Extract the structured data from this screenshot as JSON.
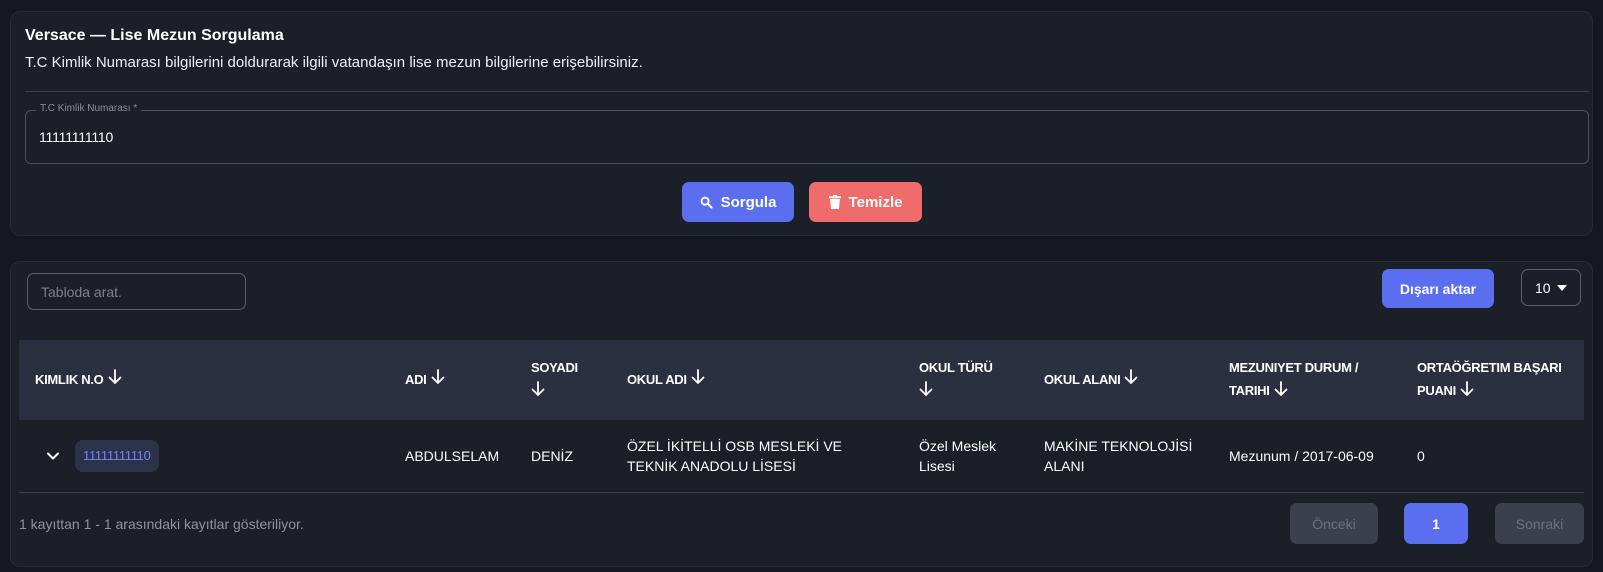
{
  "query": {
    "title": "Versace — Lise Mezun Sorgulama",
    "subtitle": "T.C Kimlik Numarası bilgilerini doldurarak ilgili vatandaşın lise mezun bilgilerine erişebilirsiniz.",
    "field_label": "T.C Kimlik Numarası *",
    "field_value": "11111111110",
    "search_label": "Sorgula",
    "clear_label": "Temizle"
  },
  "table": {
    "search_placeholder": "Tabloda arat.",
    "export_label": "Dışarı aktar",
    "page_size": "10",
    "columns": [
      "KIMLIK N.O",
      "ADI",
      "SOYADI",
      "OKUL ADI",
      "OKUL TÜRÜ",
      "OKUL ALANI",
      "MEZUNIYET DURUM / TARIHI",
      "ORTAÖĞRETIM BAŞARI PUANI"
    ],
    "rows": [
      {
        "kimlik": "11111111110",
        "adi": "ABDULSELAM",
        "soyadi": "DENİZ",
        "okul_adi": "ÖZEL İKİTELLİ OSB MESLEKİ VE TEKNİK ANADOLU LİSESİ",
        "okul_turu": "Özel Meslek Lisesi",
        "okul_alani": "MAKİNE TEKNOLOJİSİ ALANI",
        "mezuniyet": "Mezunum / 2017-06-09",
        "puan": "0"
      }
    ],
    "footer_info": "1 kayıttan 1 - 1 arasındaki kayıtlar gösteriliyor.",
    "prev_label": "Önceki",
    "current_page": "1",
    "next_label": "Sonraki"
  },
  "colors": {
    "background": "#141820",
    "card": "#1b1f28",
    "primary": "#5b6ef0",
    "danger": "#f06b6b",
    "header_row": "#2b3040",
    "id_link": "#6f82ff"
  }
}
